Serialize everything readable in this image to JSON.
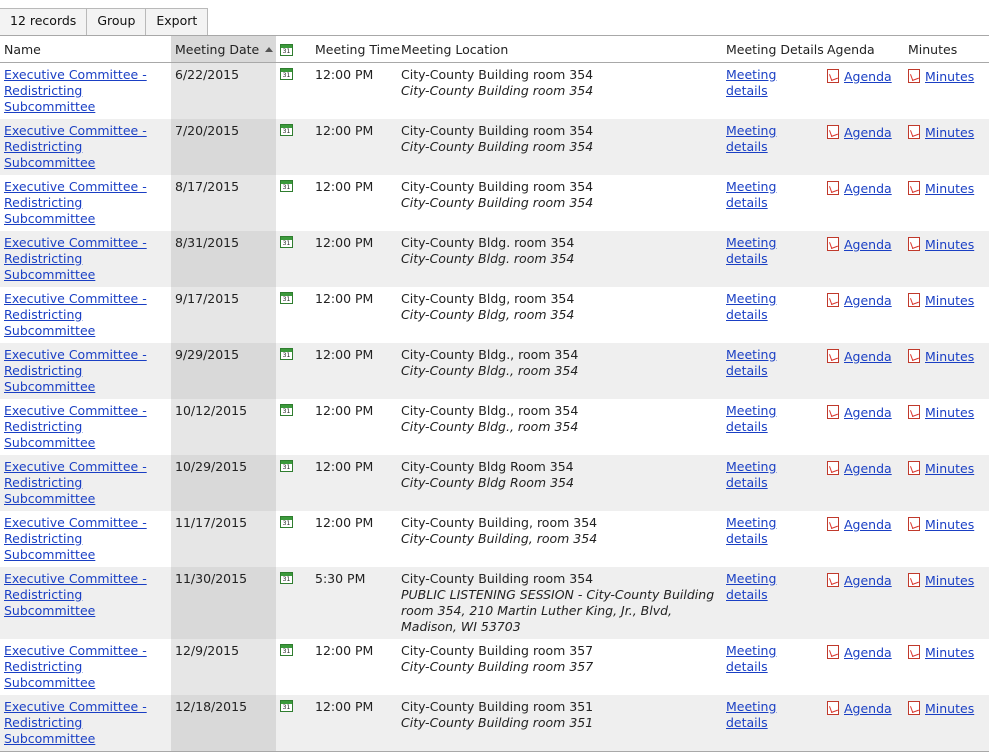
{
  "toolbar": {
    "records_label": "12 records",
    "group_label": "Group",
    "export_label": "Export"
  },
  "columns": {
    "name": "Name",
    "meeting_date": "Meeting Date",
    "meeting_time": "Meeting Time",
    "meeting_location": "Meeting Location",
    "meeting_details": "Meeting Details",
    "agenda": "Agenda",
    "minutes": "Minutes"
  },
  "calendar_icon_number": "31",
  "colors": {
    "link": "#1a3fc4",
    "sorted_column": "#d9d9d9",
    "calendar_green": "#3c9a3c",
    "pdf_red": "#d9342b"
  },
  "rows": [
    {
      "name": "Executive Committee - Redistricting Subcommittee",
      "date": "6/22/2015",
      "time": "12:00 PM",
      "location": "City-County Building room 354",
      "location_note": "City-County Building room 354",
      "details": "Meeting details",
      "agenda": "Agenda",
      "minutes": "Minutes"
    },
    {
      "name": "Executive Committee - Redistricting Subcommittee",
      "date": "7/20/2015",
      "time": "12:00 PM",
      "location": "City-County Building room 354",
      "location_note": "City-County Building room 354",
      "details": "Meeting details",
      "agenda": "Agenda",
      "minutes": "Minutes"
    },
    {
      "name": "Executive Committee - Redistricting Subcommittee",
      "date": "8/17/2015",
      "time": "12:00 PM",
      "location": "City-County Building room 354",
      "location_note": "City-County Building room 354",
      "details": "Meeting details",
      "agenda": "Agenda",
      "minutes": "Minutes"
    },
    {
      "name": "Executive Committee - Redistricting Subcommittee",
      "date": "8/31/2015",
      "time": "12:00 PM",
      "location": "City-County Bldg. room 354",
      "location_note": "City-County Bldg. room 354",
      "details": "Meeting details",
      "agenda": "Agenda",
      "minutes": "Minutes"
    },
    {
      "name": "Executive Committee - Redistricting Subcommittee",
      "date": "9/17/2015",
      "time": "12:00 PM",
      "location": "City-County Bldg, room 354",
      "location_note": "City-County Bldg, room 354",
      "details": "Meeting details",
      "agenda": "Agenda",
      "minutes": "Minutes"
    },
    {
      "name": "Executive Committee - Redistricting Subcommittee",
      "date": "9/29/2015",
      "time": "12:00 PM",
      "location": "City-County Bldg., room 354",
      "location_note": "City-County Bldg., room 354",
      "details": "Meeting details",
      "agenda": "Agenda",
      "minutes": "Minutes"
    },
    {
      "name": "Executive Committee - Redistricting Subcommittee",
      "date": "10/12/2015",
      "time": "12:00 PM",
      "location": "City-County Bldg., room 354",
      "location_note": "City-County Bldg., room 354",
      "details": "Meeting details",
      "agenda": "Agenda",
      "minutes": "Minutes"
    },
    {
      "name": "Executive Committee - Redistricting Subcommittee",
      "date": "10/29/2015",
      "time": "12:00 PM",
      "location": "City-County Bldg Room 354",
      "location_note": "City-County Bldg Room 354",
      "details": "Meeting details",
      "agenda": "Agenda",
      "minutes": "Minutes"
    },
    {
      "name": "Executive Committee - Redistricting Subcommittee",
      "date": "11/17/2015",
      "time": "12:00 PM",
      "location": "City-County Building, room 354",
      "location_note": "City-County Building, room 354",
      "details": "Meeting details",
      "agenda": "Agenda",
      "minutes": "Minutes"
    },
    {
      "name": "Executive Committee - Redistricting Subcommittee",
      "date": "11/30/2015",
      "time": "5:30 PM",
      "location": "City-County Building room 354",
      "location_note": "PUBLIC LISTENING SESSION - City-County Building room 354, 210 Martin Luther King, Jr., Blvd, Madison, WI 53703",
      "details": "Meeting details",
      "agenda": "Agenda",
      "minutes": "Minutes"
    },
    {
      "name": "Executive Committee - Redistricting Subcommittee",
      "date": "12/9/2015",
      "time": "12:00 PM",
      "location": "City-County Building room 357",
      "location_note": "City-County Building room 357",
      "details": "Meeting details",
      "agenda": "Agenda",
      "minutes": "Minutes"
    },
    {
      "name": "Executive Committee - Redistricting Subcommittee",
      "date": "12/18/2015",
      "time": "12:00 PM",
      "location": "City-County Building room 351",
      "location_note": "City-County Building room 351",
      "details": "Meeting details",
      "agenda": "Agenda",
      "minutes": "Minutes"
    }
  ]
}
